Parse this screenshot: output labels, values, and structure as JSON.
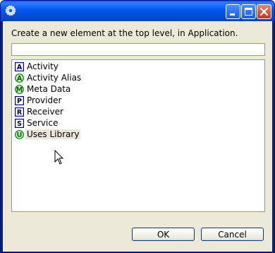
{
  "prompt": "Create a new element at the top level, in Application.",
  "filter": {
    "value": ""
  },
  "elements": [
    {
      "letter": "A",
      "label": "Activity",
      "name": "activity",
      "style": "box",
      "color": "#000080"
    },
    {
      "letter": "A",
      "label": "Activity Alias",
      "name": "activity-alias",
      "style": "circle",
      "color": "#008000"
    },
    {
      "letter": "M",
      "label": "Meta Data",
      "name": "meta-data",
      "style": "circle",
      "color": "#008000"
    },
    {
      "letter": "P",
      "label": "Provider",
      "name": "provider",
      "style": "box",
      "color": "#000080"
    },
    {
      "letter": "R",
      "label": "Receiver",
      "name": "receiver",
      "style": "box",
      "color": "#000080"
    },
    {
      "letter": "S",
      "label": "Service",
      "name": "service",
      "style": "box",
      "color": "#000080"
    },
    {
      "letter": "U",
      "label": "Uses Library",
      "name": "uses-library",
      "style": "circle",
      "color": "#008000",
      "selected": true
    }
  ],
  "buttons": {
    "ok": "OK",
    "cancel": "Cancel"
  },
  "colors": {
    "title_bar": "#0058ee",
    "dialog_bg": "#ece9d8",
    "field_border": "#7f9db9"
  }
}
